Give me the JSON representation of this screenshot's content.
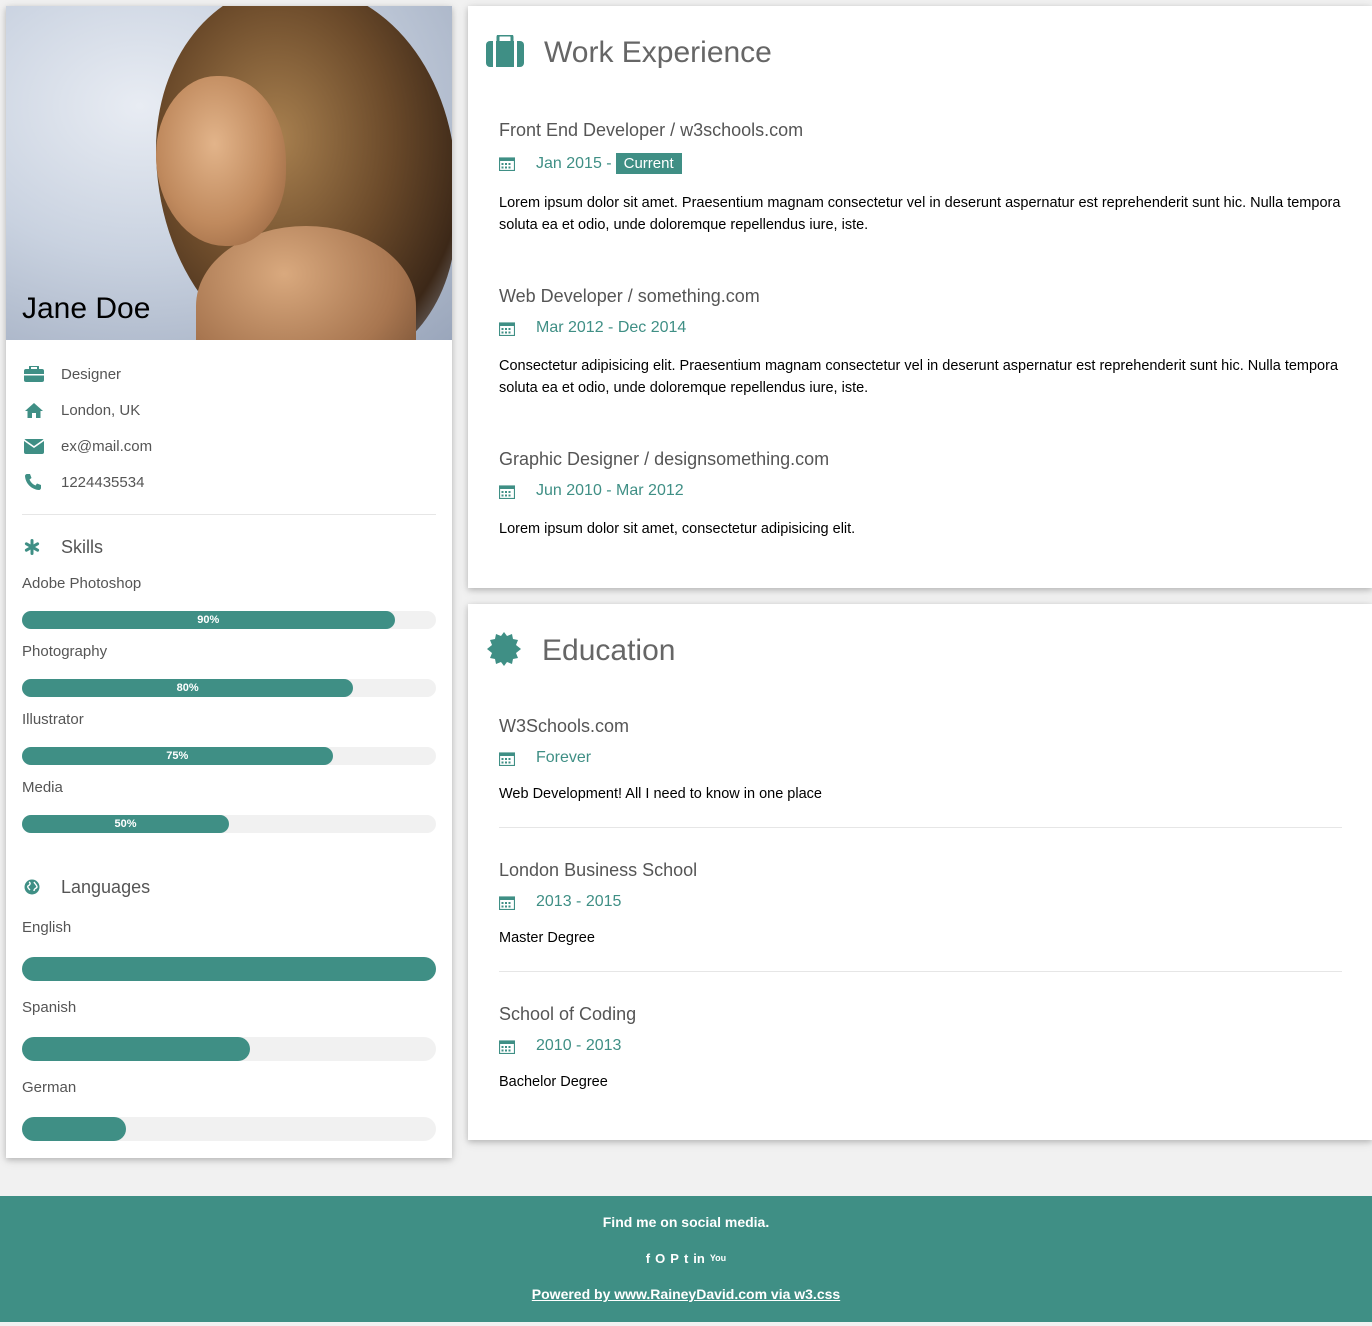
{
  "profile": {
    "name": "Jane Doe",
    "job": "Designer",
    "location": "London, UK",
    "email": "ex@mail.com",
    "phone": "1224435534"
  },
  "skills": {
    "title": "Skills",
    "items": [
      {
        "label": "Adobe Photoshop",
        "percent": 90,
        "percent_label": "90%"
      },
      {
        "label": "Photography",
        "percent": 80,
        "percent_label": "80%"
      },
      {
        "label": "Illustrator",
        "percent": 75,
        "percent_label": "75%"
      },
      {
        "label": "Media",
        "percent": 50,
        "percent_label": "50%"
      }
    ]
  },
  "languages": {
    "title": "Languages",
    "items": [
      {
        "label": "English",
        "percent": 100
      },
      {
        "label": "Spanish",
        "percent": 55
      },
      {
        "label": "German",
        "percent": 25
      }
    ]
  },
  "work": {
    "title": "Work Experience",
    "items": [
      {
        "role": "Front End Developer / w3schools.com",
        "date": "Jan 2015 -",
        "badge": "Current",
        "desc": "Lorem ipsum dolor sit amet. Praesentium magnam consectetur vel in deserunt aspernatur est reprehenderit sunt hic. Nulla tempora soluta ea et odio, unde doloremque repellendus iure, iste."
      },
      {
        "role": "Web Developer / something.com",
        "date": "Mar 2012 - Dec 2014",
        "desc": "Consectetur adipisicing elit. Praesentium magnam consectetur vel in deserunt aspernatur est reprehenderit sunt hic. Nulla tempora soluta ea et odio, unde doloremque repellendus iure, iste."
      },
      {
        "role": "Graphic Designer / designsomething.com",
        "date": "Jun 2010 - Mar 2012",
        "desc": "Lorem ipsum dolor sit amet, consectetur adipisicing elit."
      }
    ]
  },
  "education": {
    "title": "Education",
    "items": [
      {
        "school": "W3Schools.com",
        "date": "Forever",
        "desc": "Web Development! All I need to know in one place"
      },
      {
        "school": "London Business School",
        "date": "2013 - 2015",
        "desc": "Master Degree"
      },
      {
        "school": "School of Coding",
        "date": "2010 - 2013",
        "desc": "Bachelor Degree"
      }
    ]
  },
  "footer": {
    "tagline": "Find me on social media.",
    "social_icons": [
      "facebook-icon",
      "instagram-icon",
      "pinterest-icon",
      "twitter-icon",
      "linkedin-icon",
      "youtube-icon"
    ],
    "social_glyphs": [
      "f",
      "O",
      "P",
      "t",
      "in",
      "You"
    ],
    "powered": "Powered by www.RaineyDavid.com via w3.css"
  },
  "colors": {
    "accent": "#3f8f85",
    "background": "#f1f1f1",
    "muted_text": "#555555"
  }
}
